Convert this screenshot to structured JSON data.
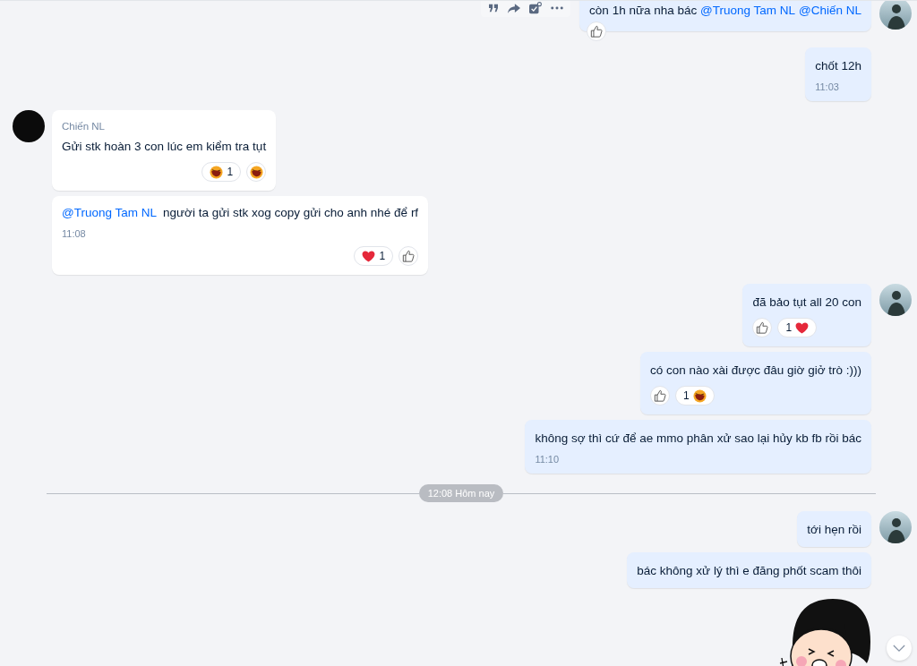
{
  "items": [
    {
      "kind": "sent",
      "avatar": true,
      "hovered": true,
      "segments": [
        {
          "kind": "text",
          "text": "còn 1h nữa nha bác "
        },
        {
          "kind": "mention",
          "text": "@Truong Tam NL"
        },
        {
          "kind": "mention",
          "text": "@Chiến NL"
        }
      ],
      "reactions": [
        {
          "kind": "like"
        }
      ]
    },
    {
      "kind": "sent",
      "avatar": false,
      "hovered": false,
      "segments": [
        {
          "kind": "text",
          "text": "chốt 12h"
        }
      ],
      "time": "11:03"
    },
    {
      "kind": "received",
      "avatar": true,
      "hovered": false,
      "sender": "Chiến NL",
      "segments": [
        {
          "kind": "text",
          "text": "Gửi stk hoàn 3 con lúc em kiểm tra tụt"
        }
      ],
      "reactions": [
        {
          "kind": "laugh",
          "count": "1"
        },
        {
          "kind": "laugh"
        }
      ]
    },
    {
      "kind": "received",
      "avatar": false,
      "hovered": false,
      "segments": [
        {
          "kind": "mention",
          "text": "@Truong Tam NL"
        },
        {
          "kind": "text",
          "text": "  người ta gửi stk xog copy gửi cho anh nhé để rf"
        }
      ],
      "time": "11:08",
      "reactions": [
        {
          "kind": "heart",
          "count": "1"
        },
        {
          "kind": "like"
        }
      ]
    },
    {
      "kind": "sent",
      "avatar": true,
      "hovered": false,
      "segments": [
        {
          "kind": "text",
          "text": "đã bảo tụt all 20 con"
        }
      ],
      "reactions": [
        {
          "kind": "like"
        },
        {
          "kind": "heart",
          "count": "1"
        }
      ]
    },
    {
      "kind": "sent",
      "avatar": false,
      "hovered": false,
      "segments": [
        {
          "kind": "text",
          "text": "có con nào xài được đâu giờ giở trò :)))"
        }
      ],
      "reactions": [
        {
          "kind": "like"
        },
        {
          "kind": "laugh",
          "count": "1"
        }
      ]
    },
    {
      "kind": "sent",
      "avatar": false,
      "hovered": false,
      "segments": [
        {
          "kind": "text",
          "text": "không sợ thì cứ để ae mmo phân xử sao lại hủy kb fb rồi bác"
        }
      ],
      "time": "11:10"
    },
    {
      "kind": "divider",
      "label": "12:08 Hôm nay"
    },
    {
      "kind": "sent",
      "avatar": true,
      "hovered": false,
      "segments": [
        {
          "kind": "text",
          "text": "tới hẹn rồi"
        }
      ]
    },
    {
      "kind": "sent",
      "avatar": false,
      "hovered": false,
      "segments": [
        {
          "kind": "text",
          "text": "bác không xử lý thì e đăng phốt scam thôi"
        }
      ]
    },
    {
      "kind": "sticker"
    }
  ]
}
